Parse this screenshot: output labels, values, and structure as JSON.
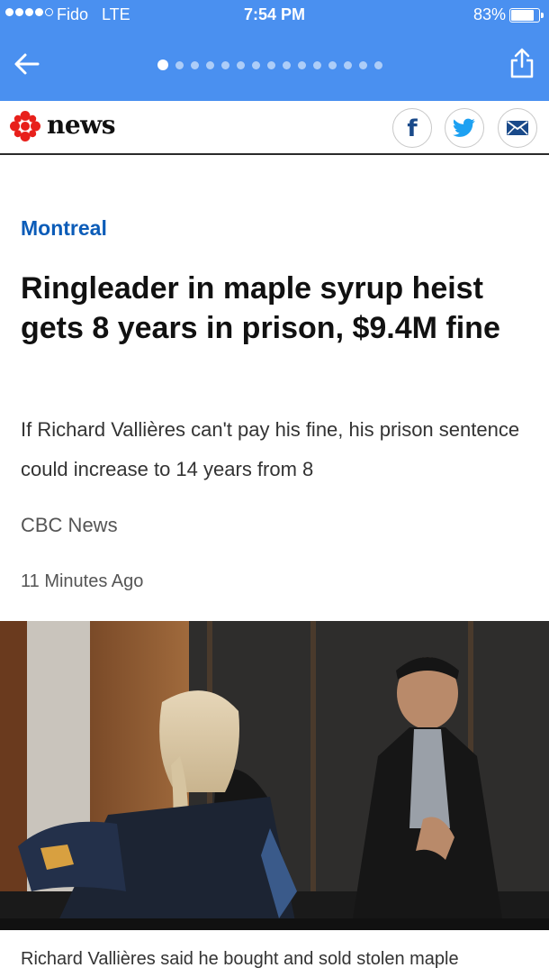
{
  "status_bar": {
    "carrier": "Fido",
    "network": "LTE",
    "time": "7:54 PM",
    "battery": "83%",
    "battery_level": 0.83
  },
  "nav": {
    "page_count": 15,
    "active_page": 1,
    "back_icon": "arrow-left-icon",
    "share_icon": "share-icon"
  },
  "header": {
    "brand": "news",
    "logo_icon": "cbc-gem-icon",
    "social_icons": [
      "facebook-icon",
      "twitter-icon",
      "email-icon"
    ]
  },
  "article": {
    "section": "Montreal",
    "headline": "Ringleader in maple syrup heist gets 8 years in prison, $9.4M fine",
    "dek": "If Richard Vallières can't pay his fine, his prison sentence could increase to 14 years from 8",
    "source": "CBC News",
    "time": "11 Minutes Ago",
    "caption": "Richard Vallières said he bought and sold stolen maple"
  },
  "colors": {
    "nav_blue": "#4a90f0",
    "section_blue": "#0b5cb8",
    "cbc_red": "#e8201b"
  }
}
